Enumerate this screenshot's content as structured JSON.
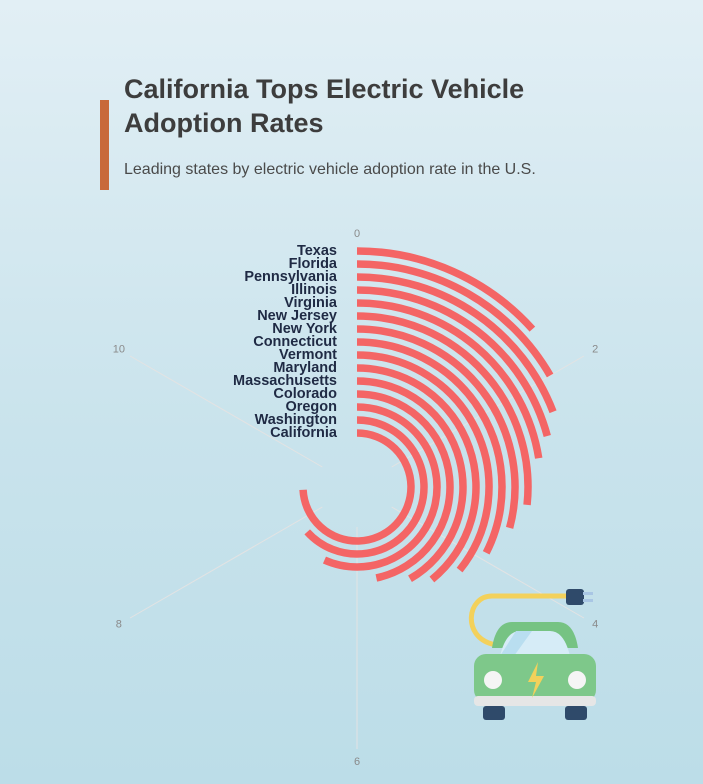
{
  "header": {
    "title": "California Tops Electric Vehicle Adoption Rates",
    "subtitle": "Leading states by electric vehicle adoption rate in the U.S."
  },
  "chart_data": {
    "type": "radial-bar",
    "title": "California Tops Electric Vehicle Adoption Rates",
    "subtitle": "Leading states by electric vehicle adoption rate in the U.S.",
    "axis_range": [
      0,
      12
    ],
    "ticks": [
      0,
      2,
      4,
      6,
      8,
      10
    ],
    "categories": [
      "Texas",
      "Florida",
      "Pennsylvania",
      "Illinois",
      "Virginia",
      "New Jersey",
      "New York",
      "Connecticut",
      "Vermont",
      "Maryland",
      "Massachusetts",
      "Colorado",
      "Oregon",
      "Washington",
      "California"
    ],
    "values": [
      1.6,
      2.0,
      2.3,
      2.5,
      2.7,
      3.2,
      3.5,
      3.9,
      4.3,
      4.7,
      5.0,
      5.6,
      6.8,
      7.6,
      8.9
    ],
    "bar_color": "#f46565"
  },
  "illustration": {
    "icon": "electric-car-icon"
  }
}
